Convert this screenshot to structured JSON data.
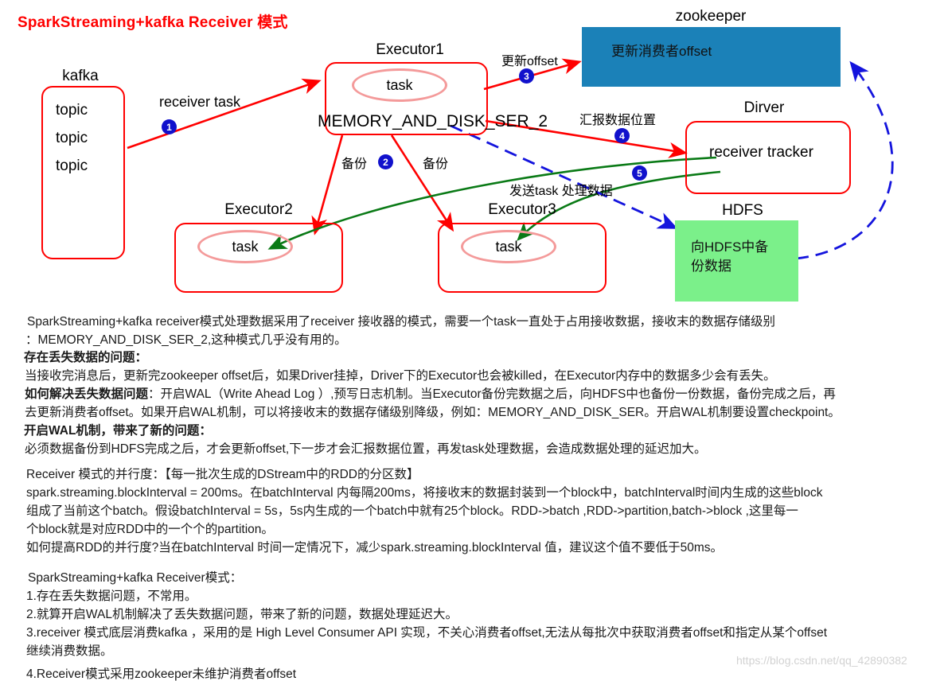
{
  "title": "SparkStreaming+kafka Receiver 模式",
  "colors": {
    "red": "#ff0000",
    "blue_badge": "#1111cc",
    "zookeeper_fill": "#1b81b8",
    "hdfs_fill": "#7bf08a",
    "green_arrow": "#0a7a16",
    "blue_dash": "#1414dd",
    "task_ellipse": "#f49a9a"
  },
  "diagram": {
    "kafka": {
      "caption": "kafka",
      "topics": [
        "topic",
        "topic",
        "topic"
      ]
    },
    "executor1": {
      "caption": "Executor1",
      "task": "task",
      "storage_level": "MEMORY_AND_DISK_SER_2"
    },
    "executor2": {
      "caption": "Executor2",
      "task": "task"
    },
    "executor3": {
      "caption": "Executor3",
      "task": "task"
    },
    "zookeeper": {
      "caption": "zookeeper",
      "body": "更新消费者offset"
    },
    "driver": {
      "caption": "Dirver",
      "body": "receiver tracker"
    },
    "hdfs": {
      "caption": "HDFS",
      "body_line1": "向HDFS中备",
      "body_line2": "份数据"
    },
    "arrows": [
      {
        "n": "1",
        "label": "receiver task"
      },
      {
        "n": "2",
        "label_left": "备份",
        "label_right": "备份"
      },
      {
        "n": "3",
        "label": "更新offset"
      },
      {
        "n": "4",
        "label": "汇报数据位置"
      },
      {
        "n": "5",
        "label": "发送task 处理数据"
      }
    ]
  },
  "prose": {
    "lines": [
      {
        "t": "SparkStreaming+kafka receiver模式处理数据采用了receiver 接收器的模式，需要一个task一直处于占用接收数据，接收末的数据存储级别",
        "bold": false
      },
      {
        "t": "：MEMORY_AND_DISK_SER_2,这种模式几乎没有用的。",
        "bold": false
      },
      {
        "t": "存在丢失数据的问题：",
        "bold": true
      },
      {
        "t": "当接收完消息后，更新完zookeeper offset后，如果Driver挂掉，Driver下的Executor也会被killed，在Executor内存中的数据多少会有丢失。",
        "bold": false
      },
      {
        "t": "如何解决丢失数据问题：开启WAL（Write Ahead Log ）,预写日志机制。当Executor备份完数据之后，向HDFS中也备份一份数据，备份完成之后，再",
        "bold": "mixed-wal"
      },
      {
        "t": "去更新消费者offset。如果开启WAL机制，可以将接收末的数据存储级别降级，例如：MEMORY_AND_DISK_SER。开启WAL机制要设置checkpoint。",
        "bold": false
      },
      {
        "t": "开启WAL机制，带来了新的问题：",
        "bold": true
      },
      {
        "t": "必须数据备份到HDFS完成之后，才会更新offset,下一步才会汇报数据位置，再发task处理数据，会造成数据处理的延迟加大。",
        "bold": false
      },
      {
        "t": "Receiver 模式的并行度：【每一批次生成的DStream中的RDD的分区数】",
        "bold": false
      },
      {
        "t": "spark.streaming.blockInterval = 200ms。在batchInterval 内每隔200ms，将接收末的数据封装到一个block中，batchInterval时间内生成的这些block",
        "bold": false
      },
      {
        "t": "组成了当前这个batch。假设batchInterval = 5s，5s内生成的一个batch中就有25个block。RDD->batch ,RDD->partition,batch->block ,这里每一",
        "bold": false
      },
      {
        "t": "个block就是对应RDD中的一个个的partition。",
        "bold": false
      },
      {
        "t": "如何提高RDD的并行度?当在batchInterval 时间一定情况下，减少spark.streaming.blockInterval 值，建议这个值不要低于50ms。",
        "bold": false
      },
      {
        "t": "SparkStreaming+kafka Receiver模式：",
        "bold": false
      },
      {
        "t": "1.存在丢失数据问题，不常用。",
        "bold": false
      },
      {
        "t": "2.就算开启WAL机制解决了丢失数据问题，带来了新的问题，数据处理延迟大。",
        "bold": false
      },
      {
        "t": "3.receiver 模式底层消费kafka ，采用的是 High Level Consumer API 实现，不关心消费者offset,无法从每批次中获取消费者offset和指定从某个offset",
        "bold": false
      },
      {
        "t": "继续消费数据。",
        "bold": false
      },
      {
        "t": "4.Receiver模式采用zookeeper未维护消费者offset",
        "bold": false
      }
    ],
    "bold_prefix_line4": "如何解决丢失数据问题",
    "watermark": "https://blog.csdn.net/qq_42890382"
  }
}
